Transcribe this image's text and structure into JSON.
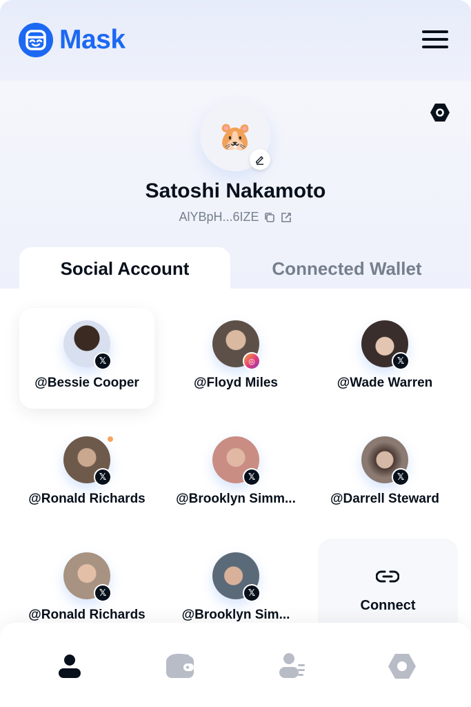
{
  "app": {
    "name": "Mask",
    "brand_color": "#1c68f3"
  },
  "profile": {
    "name": "Satoshi Nakamoto",
    "address": "AlYBpH...6IZE",
    "avatar_emoji": "🐹"
  },
  "tabs": [
    {
      "label": "Social Account",
      "active": true
    },
    {
      "label": "Connected Wallet",
      "active": false
    }
  ],
  "accounts": [
    {
      "handle": "@Bessie Cooper",
      "platform": "x",
      "selected": true,
      "notification": false,
      "avatar_color": "#c9d3ea"
    },
    {
      "handle": "@Floyd Miles",
      "platform": "instagram",
      "selected": false,
      "notification": false,
      "avatar_color": "#5d5048"
    },
    {
      "handle": "@Wade Warren",
      "platform": "x",
      "selected": false,
      "notification": false,
      "avatar_color": "#3a2e2c"
    },
    {
      "handle": "@Ronald Richards",
      "platform": "x",
      "selected": false,
      "notification": true,
      "avatar_color": "#6e5a4b"
    },
    {
      "handle": "@Brooklyn Simm...",
      "platform": "x",
      "selected": false,
      "notification": false,
      "avatar_color": "#c98d83"
    },
    {
      "handle": "@Darrell Steward",
      "platform": "x",
      "selected": false,
      "notification": false,
      "avatar_color": "#8a7a72"
    },
    {
      "handle": "@Ronald Richards",
      "platform": "x",
      "selected": false,
      "notification": false,
      "avatar_color": "#a89282"
    },
    {
      "handle": "@Brooklyn Sim...",
      "platform": "x",
      "selected": false,
      "notification": false,
      "avatar_color": "#5b6a78"
    }
  ],
  "connect": {
    "label": "Connect"
  },
  "platform_badges": {
    "x": "𝕏",
    "instagram": "◎"
  },
  "bottom_nav": [
    {
      "icon": "person-icon",
      "active": true
    },
    {
      "icon": "wallet-icon",
      "active": false
    },
    {
      "icon": "contacts-icon",
      "active": false
    },
    {
      "icon": "settings-icon",
      "active": false
    }
  ]
}
